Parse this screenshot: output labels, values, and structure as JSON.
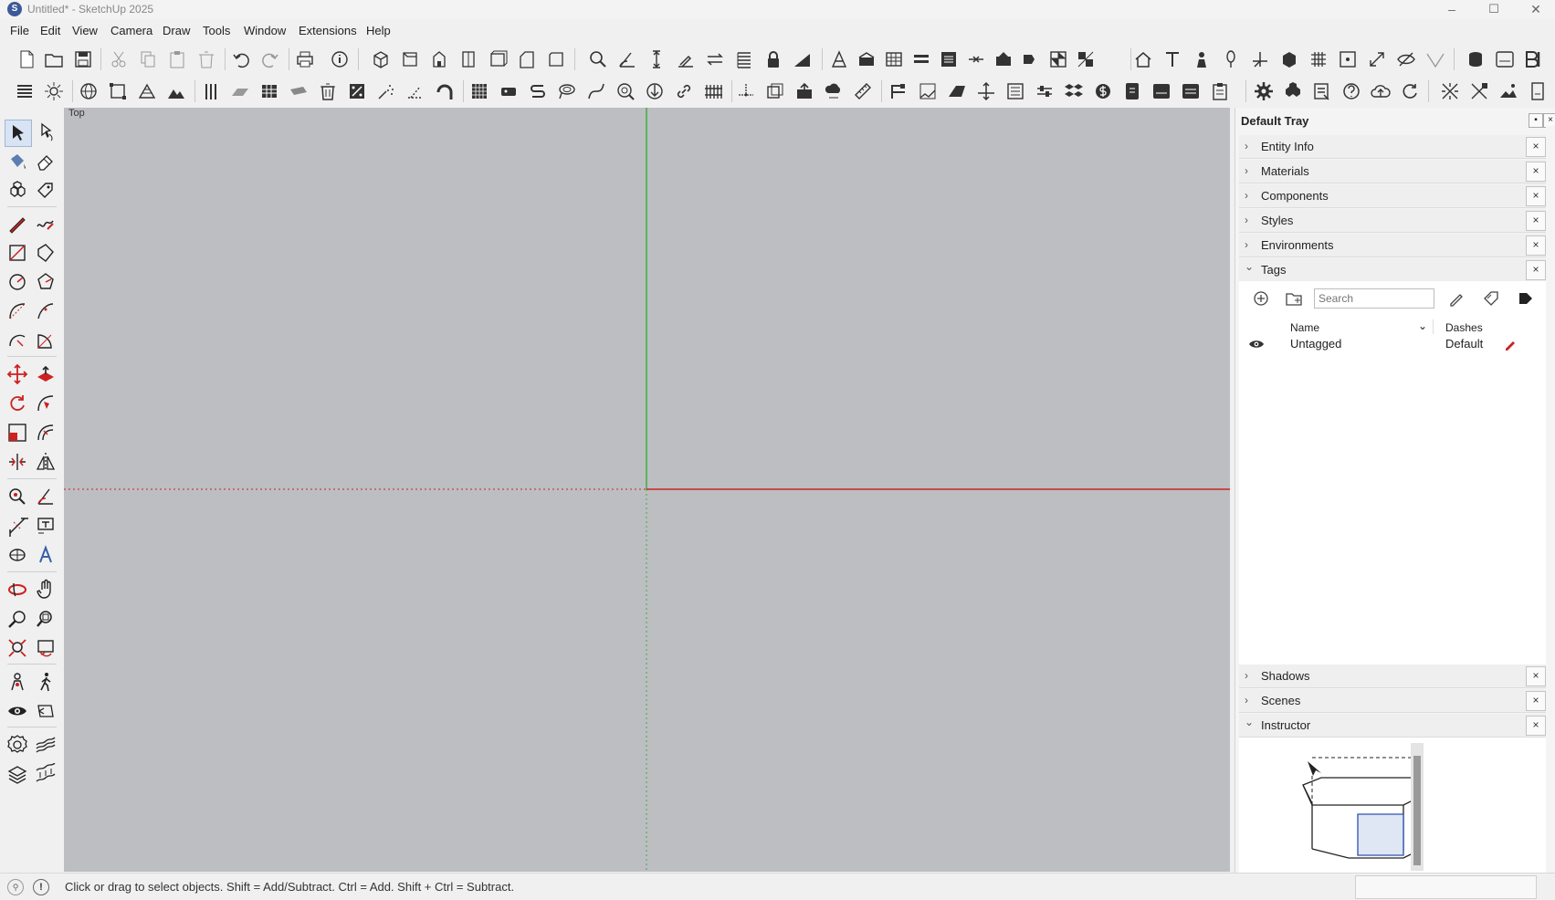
{
  "window": {
    "title": "Untitled* - SketchUp 2025",
    "logo": "S",
    "minimize": "–",
    "maximize": "☐",
    "close": "✕"
  },
  "menu": {
    "items": [
      "File",
      "Edit",
      "View",
      "Camera",
      "Draw",
      "Tools",
      "Window",
      "Extensions",
      "Help"
    ]
  },
  "viewport": {
    "view_label": "Top",
    "colors": {
      "background": "#bcbec2",
      "green_axis": "#3fae3f",
      "red_axis": "#cc2222"
    }
  },
  "tray": {
    "title": "Default Tray",
    "panels_top": [
      {
        "name": "Entity Info",
        "expanded": false
      },
      {
        "name": "Materials",
        "expanded": false
      },
      {
        "name": "Components",
        "expanded": false
      },
      {
        "name": "Styles",
        "expanded": false
      },
      {
        "name": "Environments",
        "expanded": false
      },
      {
        "name": "Tags",
        "expanded": true
      }
    ],
    "panels_bottom": [
      {
        "name": "Shadows",
        "expanded": false
      },
      {
        "name": "Scenes",
        "expanded": false
      },
      {
        "name": "Instructor",
        "expanded": true
      }
    ],
    "tags": {
      "search_placeholder": "Search",
      "col_name": "Name",
      "col_dashes": "Dashes",
      "rows": [
        {
          "name": "Untagged",
          "dashes": "Default"
        }
      ]
    }
  },
  "status": {
    "text": "Click or drag to select objects. Shift = Add/Subtract. Ctrl = Add. Shift + Ctrl = Subtract."
  },
  "icons": {
    "collapse_chevron": "›",
    "expand_chevron": "⌄",
    "close_glyph": "×",
    "sort_chevron": "⌄"
  }
}
